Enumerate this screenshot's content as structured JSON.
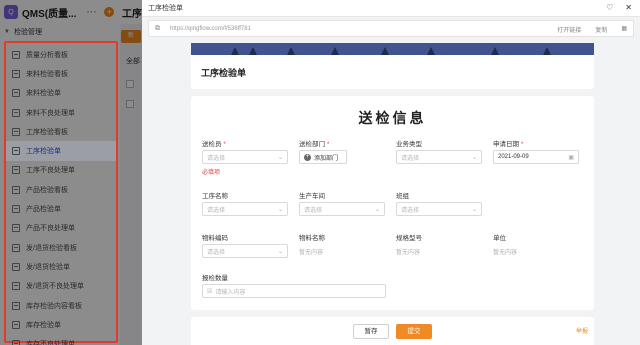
{
  "app": {
    "title": "QMS(质量...",
    "logo_text": "Q",
    "page_title": "工序检",
    "action_button": "新",
    "tab_label": "全部",
    "colors": {
      "brand": "#7b61d9",
      "accent": "#f08a24",
      "highlight": "#e23b2e"
    }
  },
  "sidebar": {
    "group_label": "检验管理",
    "items": [
      {
        "label": "质量分析看板",
        "icon": "dashboard-icon"
      },
      {
        "label": "来料检验看板",
        "icon": "dashboard-icon"
      },
      {
        "label": "来料检验单",
        "icon": "form-icon"
      },
      {
        "label": "来料不良处理单",
        "icon": "form-icon"
      },
      {
        "label": "工序检验看板",
        "icon": "dashboard-icon"
      },
      {
        "label": "工序检验单",
        "icon": "form-icon"
      },
      {
        "label": "工序不良处理单",
        "icon": "form-icon"
      },
      {
        "label": "产品检验看板",
        "icon": "dashboard-icon"
      },
      {
        "label": "产品检验单",
        "icon": "form-icon"
      },
      {
        "label": "产品不良处理单",
        "icon": "form-icon"
      },
      {
        "label": "发/退货检验看板",
        "icon": "dashboard-icon"
      },
      {
        "label": "发/退货检验单",
        "icon": "form-icon"
      },
      {
        "label": "发/退货不良处理单",
        "icon": "form-icon"
      },
      {
        "label": "库存检验内容看板",
        "icon": "dashboard-icon"
      },
      {
        "label": "库存检验单",
        "icon": "form-icon"
      },
      {
        "label": "库存不良处理单",
        "icon": "form-icon"
      }
    ]
  },
  "modal": {
    "window_title": "工序检验单",
    "url": "https://qingflow.com/f/536ff781",
    "url_actions": {
      "open": "打开链接",
      "copy": "复制"
    },
    "form_header": "工序检验单",
    "form_title": "送检信息",
    "fields": {
      "inspector": {
        "label": "送检员",
        "placeholder": "请选择",
        "error": "必填项"
      },
      "department": {
        "label": "送检部门",
        "button": "添加部门"
      },
      "business_type": {
        "label": "业务类型",
        "placeholder": "请选择"
      },
      "apply_date": {
        "label": "申请日期",
        "value": "2021-09-09"
      },
      "process_name": {
        "label": "工序名称",
        "placeholder": "请选择"
      },
      "workshop": {
        "label": "生产车间",
        "placeholder": "请选择"
      },
      "team": {
        "label": "班组",
        "placeholder": "请选择"
      },
      "material_code": {
        "label": "物料编码",
        "placeholder": "请选择"
      },
      "material_name": {
        "label": "物料名称",
        "value": "暂无内容"
      },
      "spec_model": {
        "label": "规格型号",
        "value": "暂无内容"
      },
      "unit": {
        "label": "单位",
        "value": "暂无内容"
      },
      "inspect_qty": {
        "label": "报检数量",
        "placeholder": "请输入内容"
      }
    },
    "footer": {
      "save": "暂存",
      "submit": "提交",
      "report": "举报"
    }
  }
}
